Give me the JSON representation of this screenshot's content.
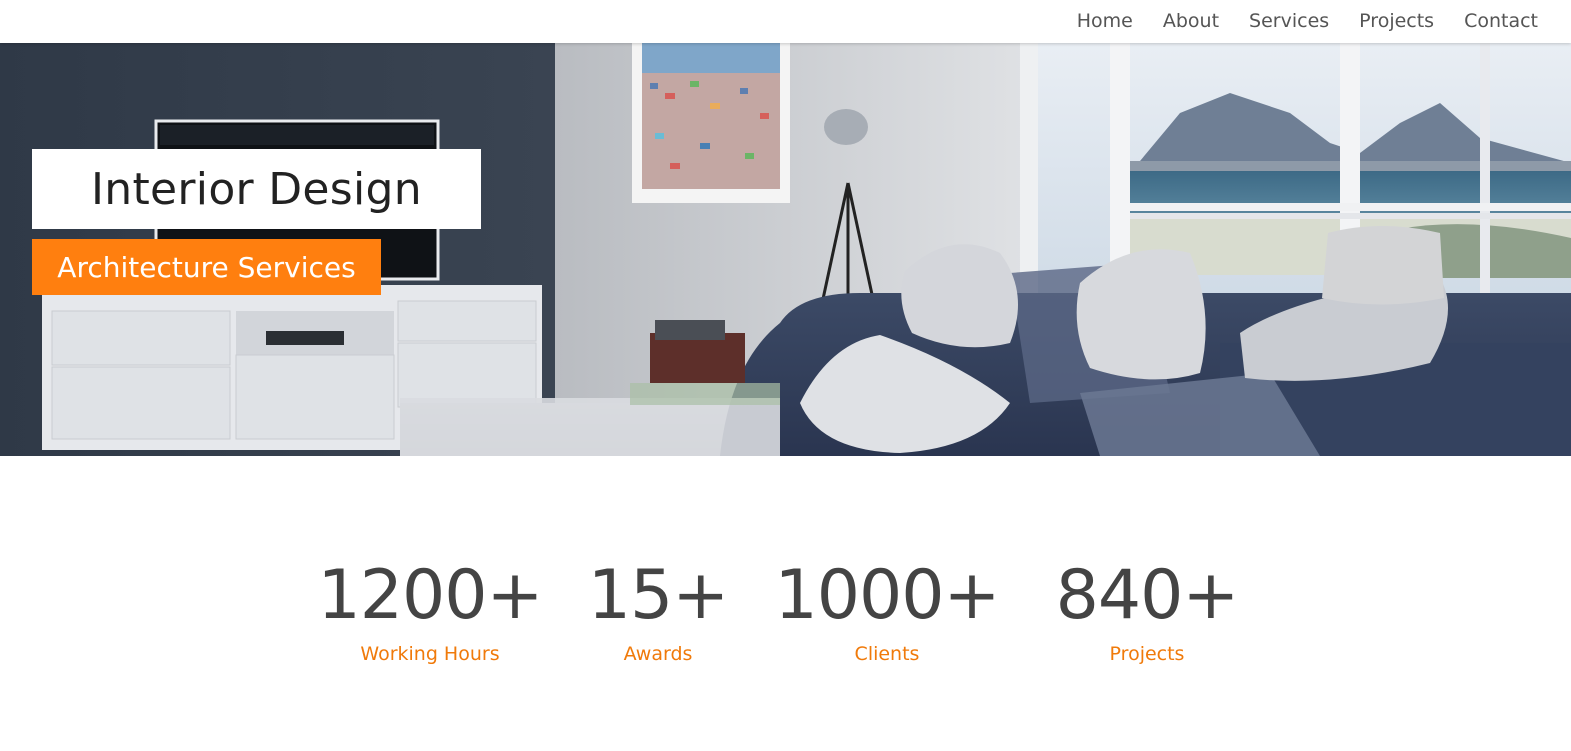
{
  "nav": {
    "items": [
      {
        "label": "Home"
      },
      {
        "label": "About"
      },
      {
        "label": "Services"
      },
      {
        "label": "Projects"
      },
      {
        "label": "Contact"
      }
    ]
  },
  "hero": {
    "title": "Interior Design",
    "subtitle": "Architecture Services"
  },
  "stats": [
    {
      "number": "1200+",
      "label": "Working Hours"
    },
    {
      "number": "15+",
      "label": "Awards"
    },
    {
      "number": "1000+",
      "label": "Clients"
    },
    {
      "number": "840+",
      "label": "Projects"
    }
  ],
  "colors": {
    "accent": "#ff7f0f",
    "stat_label": "#f07a0a",
    "text_dark": "#444444"
  }
}
